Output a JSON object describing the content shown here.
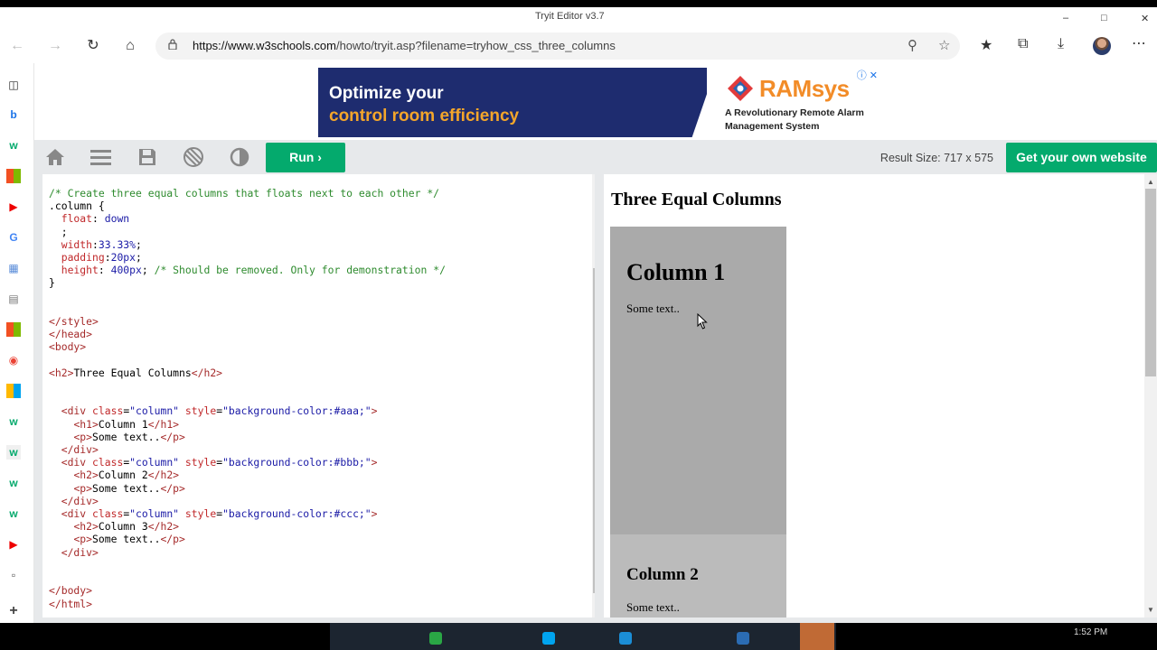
{
  "window": {
    "title": "Tryit Editor v3.7"
  },
  "browser": {
    "url_host": "https://www.w3schools.com",
    "url_path": "/howto/tryit.asp?filename=tryhow_css_three_columns"
  },
  "ad": {
    "headline_1": "Optimize your",
    "headline_2": "control room efficiency",
    "brand": "RAMsys",
    "tagline": "A Revolutionary Remote Alarm Management System",
    "close": "ⓘ ✕"
  },
  "toolbar": {
    "run_label": "Run",
    "result_size": "Result Size: 717 x 575",
    "get_website_label": "Get your own website"
  },
  "result": {
    "title": "Three Equal Columns",
    "col1_heading": "Column 1",
    "col1_text": "Some text..",
    "col2_heading": "Column 2",
    "col2_text": "Some text.."
  },
  "taskbar": {
    "clock": "1:52 PM"
  },
  "colors": {
    "w3_green": "#04aa6d",
    "toolbar_gray": "#e7e9eb",
    "col1_bg": "#aaa",
    "col2_bg": "#bbb"
  }
}
